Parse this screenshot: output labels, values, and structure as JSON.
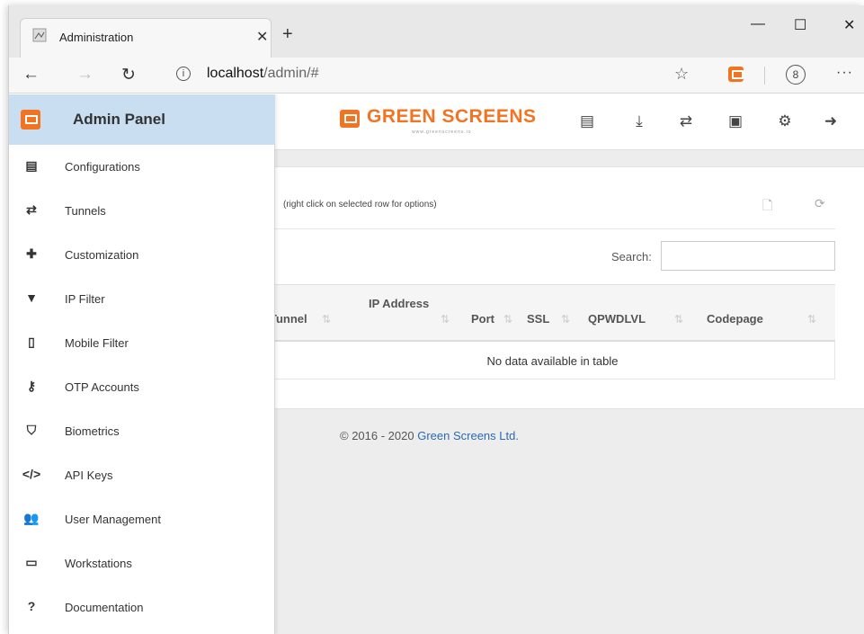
{
  "browser": {
    "tab_title": "Administration",
    "url_host": "localhost",
    "url_path": "/admin/#"
  },
  "sidebar": {
    "title": "Admin Panel",
    "items": [
      {
        "label": "Configurations",
        "icon": "list-icon"
      },
      {
        "label": "Tunnels",
        "icon": "exchange-icon"
      },
      {
        "label": "Customization",
        "icon": "puzzle-icon"
      },
      {
        "label": "IP Filter",
        "icon": "filter-icon"
      },
      {
        "label": "Mobile Filter",
        "icon": "mobile-icon"
      },
      {
        "label": "OTP Accounts",
        "icon": "key-icon"
      },
      {
        "label": "Biometrics",
        "icon": "shield-icon"
      },
      {
        "label": "API Keys",
        "icon": "code-icon"
      },
      {
        "label": "User Management",
        "icon": "users-icon"
      },
      {
        "label": "Workstations",
        "icon": "desktop-icon"
      },
      {
        "label": "Documentation",
        "icon": "question-icon"
      }
    ]
  },
  "header": {
    "logo_text": "GREEN SCREENS",
    "logo_sub": "www.greenscreens.io"
  },
  "content": {
    "hint": "(right click on selected row for options)",
    "search_label": "Search:",
    "columns": [
      "Tunnel",
      "IP Address",
      "Port",
      "SSL",
      "QPWDLVL",
      "Codepage"
    ],
    "empty_message": "No data available in table"
  },
  "footer": {
    "copyright": "© 2016 - 2020",
    "company": "Green Screens Ltd."
  },
  "colors": {
    "brand_orange": "#f27422",
    "sidebar_header": "#c9def1",
    "link": "#2a6ab3"
  }
}
